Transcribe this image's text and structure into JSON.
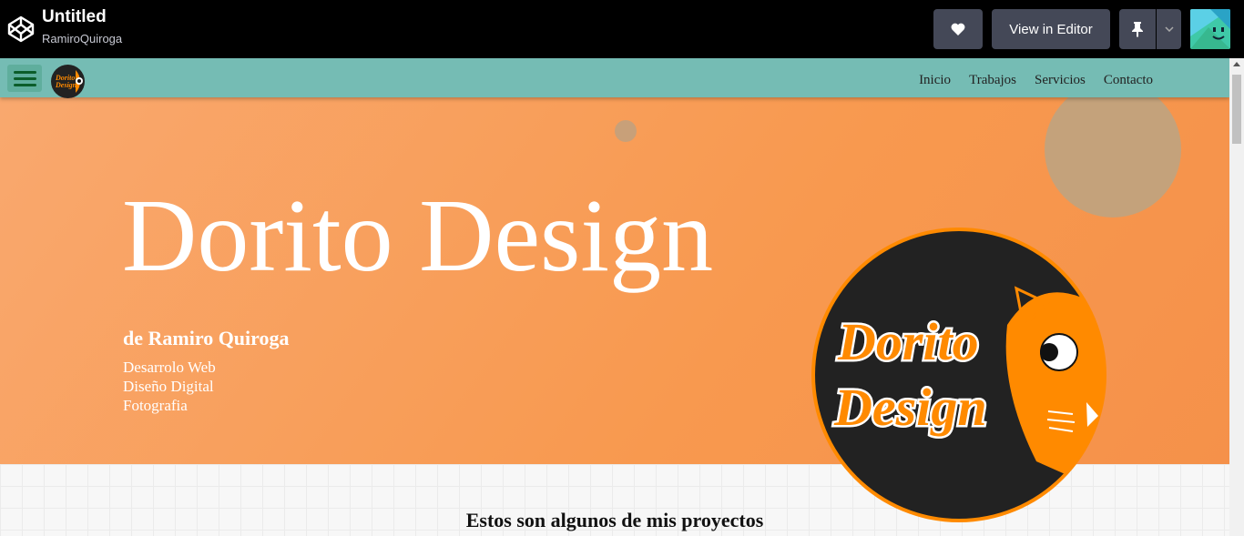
{
  "codepen": {
    "title": "Untitled",
    "user": "RamiroQuiroga",
    "view_in_editor": "View in Editor",
    "icons": [
      "codepen-logo-icon",
      "heart-icon",
      "pin-icon",
      "chevron-down-icon",
      "avatar"
    ]
  },
  "nav": {
    "links": [
      "Inicio",
      "Trabajos",
      "Servicios",
      "Contacto"
    ]
  },
  "hero": {
    "title": "Dorito Design",
    "subtitle": "de Ramiro Quiroga",
    "services": [
      "Desarrolo Web",
      "Diseño Digital",
      "Fotografia"
    ]
  },
  "logo": {
    "line1": "Dorito",
    "line2": "Design"
  },
  "projects": {
    "heading": "Estos son algunos de mis proyectos"
  },
  "colors": {
    "nav": "#75bcb4",
    "hero": "#f8994f",
    "accent": "#ff8a00"
  }
}
